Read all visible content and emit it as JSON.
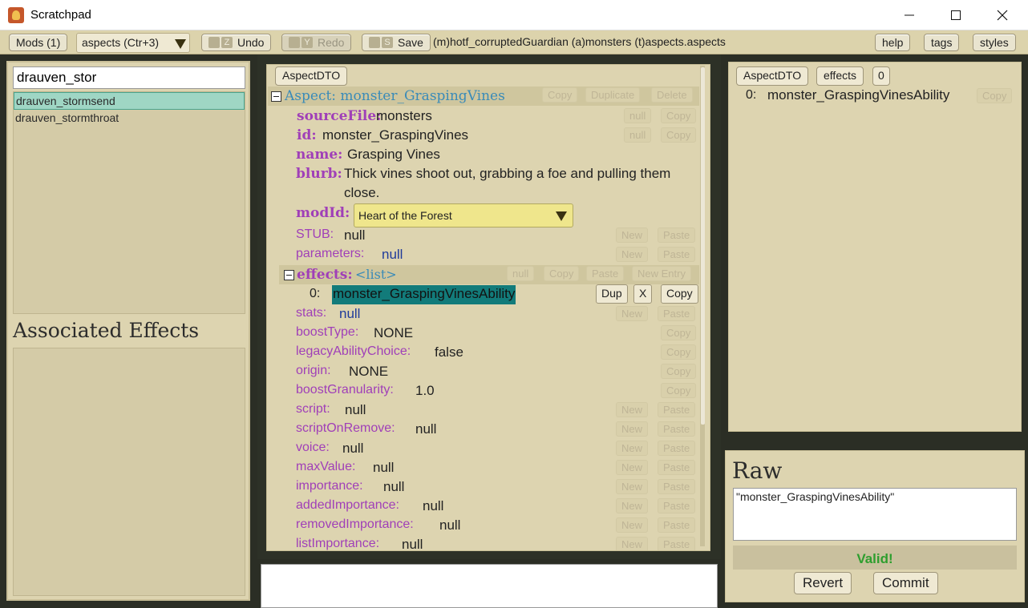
{
  "window": {
    "title": "Scratchpad",
    "minimize_glyph": "—",
    "maximize_glyph": "☐",
    "close_glyph": "✕"
  },
  "toolbar": {
    "mods_label": "Mods (1)",
    "type_select_value": "aspects (Ctr+3)",
    "undo_label": "Undo",
    "undo_key": "Z",
    "redo_label": "Redo",
    "redo_key": "Y",
    "save_label": "Save",
    "save_key": "S",
    "path": "(m)hotf_corruptedGuardian (a)monsters (t)aspects.aspects",
    "help_label": "help",
    "tags_label": "tags",
    "styles_label": "styles"
  },
  "left": {
    "search_value": "drauven_stor",
    "items": [
      "drauven_stormsend",
      "drauven_stormthroat"
    ],
    "assoc_title": "Associated Effects"
  },
  "editor": {
    "dto_button": "AspectDTO",
    "aspect_title": "Aspect: monster_GraspingVines",
    "ghost_copy": "Copy",
    "ghost_duplicate": "Duplicate",
    "ghost_delete": "Delete",
    "ghost_null": "null",
    "ghost_new": "New",
    "ghost_paste": "Paste",
    "ghost_new_entry": "New Entry",
    "fields": {
      "sourceFile": {
        "key": "sourceFile:",
        "value": "monsters"
      },
      "id": {
        "key": "id:",
        "value": "monster_GraspingVines"
      },
      "name": {
        "key": "name:",
        "value": "Grasping Vines"
      },
      "blurb": {
        "key": "blurb:",
        "value_line1": "Thick vines shoot out, grabbing a foe and pulling them",
        "value_line2": "close."
      },
      "modId": {
        "key": "modId:",
        "value": "Heart of the Forest"
      },
      "STUB": {
        "key": "STUB:",
        "value": "null"
      },
      "parameters": {
        "key": "parameters:",
        "value": "null"
      },
      "effects": {
        "key": "effects:",
        "value": "<list>",
        "index": "0:",
        "item": "monster_GraspingVinesAbility",
        "dup": "Dup",
        "x": "X",
        "copy": "Copy"
      },
      "stats": {
        "key": "stats:",
        "value": "null"
      },
      "boostType": {
        "key": "boostType:",
        "value": "NONE"
      },
      "legacyAbilityChoice": {
        "key": "legacyAbilityChoice:",
        "value": "false"
      },
      "origin": {
        "key": "origin:",
        "value": "NONE"
      },
      "boostGranularity": {
        "key": "boostGranularity:",
        "value": "1.0"
      },
      "script": {
        "key": "script:",
        "value": "null"
      },
      "scriptOnRemove": {
        "key": "scriptOnRemove:",
        "value": "null"
      },
      "voice": {
        "key": "voice:",
        "value": "null"
      },
      "maxValue": {
        "key": "maxValue:",
        "value": "null"
      },
      "importance": {
        "key": "importance:",
        "value": "null"
      },
      "addedImportance": {
        "key": "addedImportance:",
        "value": "null"
      },
      "removedImportance": {
        "key": "removedImportance:",
        "value": "null"
      },
      "listImportance": {
        "key": "listImportance:",
        "value": "null"
      }
    }
  },
  "right": {
    "breadcrumb": [
      "AspectDTO",
      "effects",
      "0"
    ],
    "entry_index": "0:",
    "entry_value": "monster_GraspingVinesAbility",
    "ghost_copy": "Copy"
  },
  "raw": {
    "title": "Raw",
    "content": "\"monster_GraspingVinesAbility\"",
    "status": "Valid!",
    "revert_label": "Revert",
    "commit_label": "Commit"
  },
  "colors": {
    "panel_bg": "#ddd4b0",
    "key_purple": "#a03fb8",
    "list_blue": "#3a8bb8",
    "selection_teal": "#127b7a",
    "valid_green": "#2e9e2e",
    "modid_yellow": "#efe68c"
  }
}
